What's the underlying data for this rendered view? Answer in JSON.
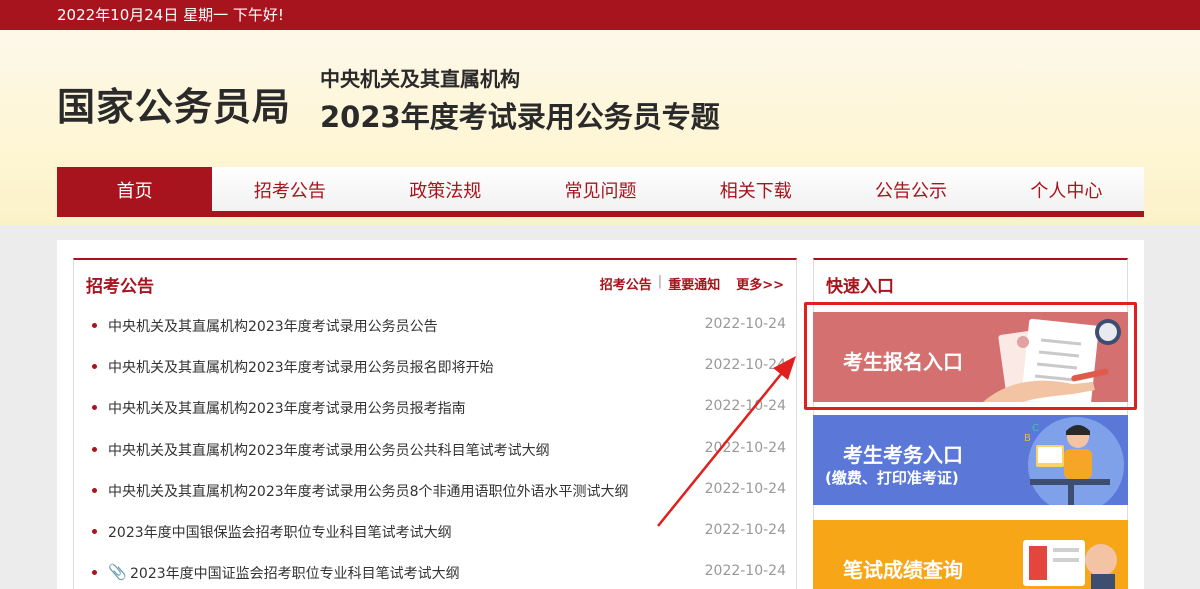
{
  "topbar": {
    "text": "2022年10月24日  星期一  下午好!"
  },
  "header": {
    "site_title": "国家公务员局",
    "subtitle_1": "中央机关及其直属机构",
    "subtitle_2": "2023年度考试录用公务员专题"
  },
  "nav": {
    "items": [
      "首页",
      "招考公告",
      "政策法规",
      "常见问题",
      "相关下载",
      "公告公示",
      "个人中心"
    ],
    "active": "首页"
  },
  "announcements": {
    "title": "招考公告",
    "links": [
      "招考公告",
      "重要通知",
      "更多>>"
    ],
    "items": [
      {
        "title": "中央机关及其直属机构2023年度考试录用公务员公告",
        "date": "2022-10-24"
      },
      {
        "title": "中央机关及其直属机构2023年度考试录用公务员报名即将开始",
        "date": "2022-10-24"
      },
      {
        "title": "中央机关及其直属机构2023年度考试录用公务员报考指南",
        "date": "2022-10-24"
      },
      {
        "title": "中央机关及其直属机构2023年度考试录用公务员公共科目笔试考试大纲",
        "date": "2022-10-24"
      },
      {
        "title": "中央机关及其直属机构2023年度考试录用公务员8个非通用语职位外语水平测试大纲",
        "date": "2022-10-24"
      },
      {
        "title": "2023年度中国银保监会招考职位专业科目笔试考试大纲",
        "date": "2022-10-24"
      },
      {
        "title": "2023年度中国证监会招考职位专业科目笔试考试大纲",
        "date": "2022-10-24"
      }
    ]
  },
  "quick": {
    "title": "快速入口",
    "banners": [
      {
        "label": "考生报名入口"
      },
      {
        "label": "考生考务入口",
        "sub": "(缴费、打印准考证)"
      },
      {
        "label": "笔试成绩查询"
      }
    ]
  },
  "colors": {
    "primary": "#a8141d",
    "highlight": "#e0201e",
    "b1": "#d4706f",
    "b2": "#5b78d8",
    "b3": "#f6a617"
  },
  "icons": [
    "paperclip-icon",
    "clock-icon",
    "document-icon",
    "person-at-desk-icon"
  ]
}
